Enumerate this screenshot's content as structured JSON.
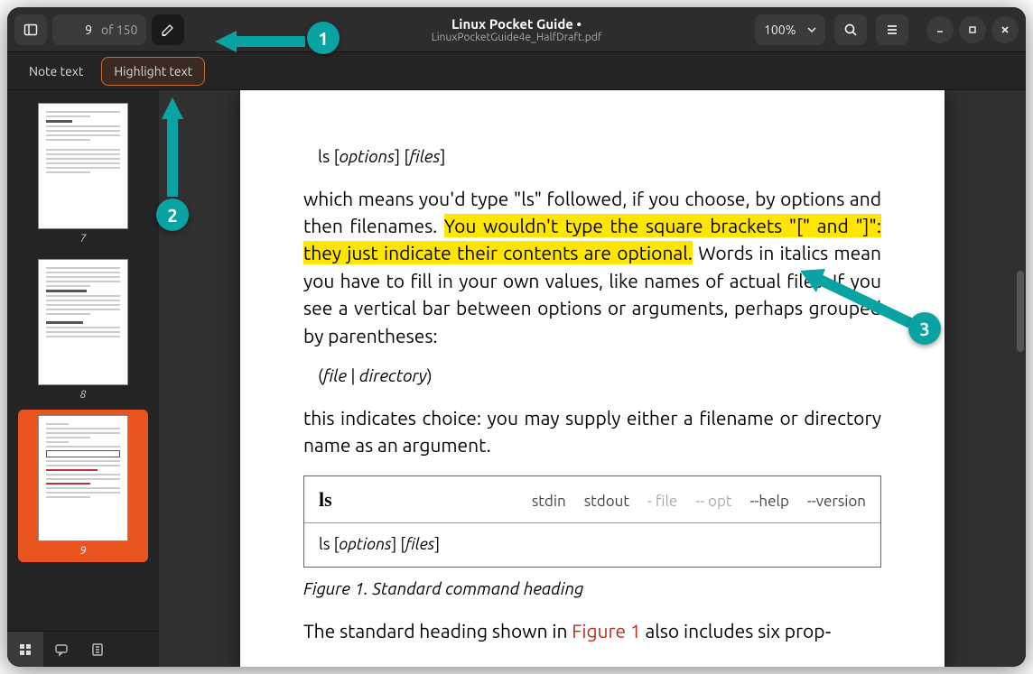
{
  "header": {
    "page_number": "9",
    "page_of": "of 150",
    "title": "Linux Pocket Guide •",
    "subtitle": "LinuxPocketGuide4e_HalfDraft.pdf",
    "zoom_label": "100%"
  },
  "annotation_bar": {
    "note_label": "Note text",
    "highlight_label": "Highlight text"
  },
  "thumbnails": {
    "labels": [
      "7",
      "8",
      "9"
    ]
  },
  "document": {
    "cmd1_prefix": "ls [",
    "cmd1_opt": "options",
    "cmd1_mid": "] [",
    "cmd1_files": "files",
    "cmd1_suffix": "]",
    "para1_lead": "which means you'd type \"ls\" followed, if you choose, by options and then filenames. ",
    "para1_highlight": "You wouldn't type the square brackets \"[\" and \"]\": they just indicate their contents are optional.",
    "para1_trail": " Words in italics mean you have to fill in your own values, like names of actual files. If you see a vertical bar between options or arguments, perhaps grouped by parentheses:",
    "cmd2_prefix": "(",
    "cmd2_file": "file",
    "cmd2_mid": " | ",
    "cmd2_dir": "directory",
    "cmd2_suffix": ")",
    "para2": "this indicates choice: you may supply either a filename or directory name as an argument.",
    "fig": {
      "name": "ls",
      "flags": [
        "stdin",
        "stdout",
        "- file",
        "-- opt",
        "--help",
        "--version"
      ],
      "dim_flags": [
        2,
        3
      ],
      "usage_prefix": "ls [",
      "usage_opt": "options",
      "usage_mid": "] [",
      "usage_files": "files",
      "usage_suffix": "]"
    },
    "figcaption": "Figure 1. Standard command heading",
    "para3_lead": "The standard heading shown in ",
    "para3_link": "Figure 1",
    "para3_trail": " also includes six prop‑"
  },
  "callouts": {
    "c1": "1",
    "c2": "2",
    "c3": "3"
  }
}
